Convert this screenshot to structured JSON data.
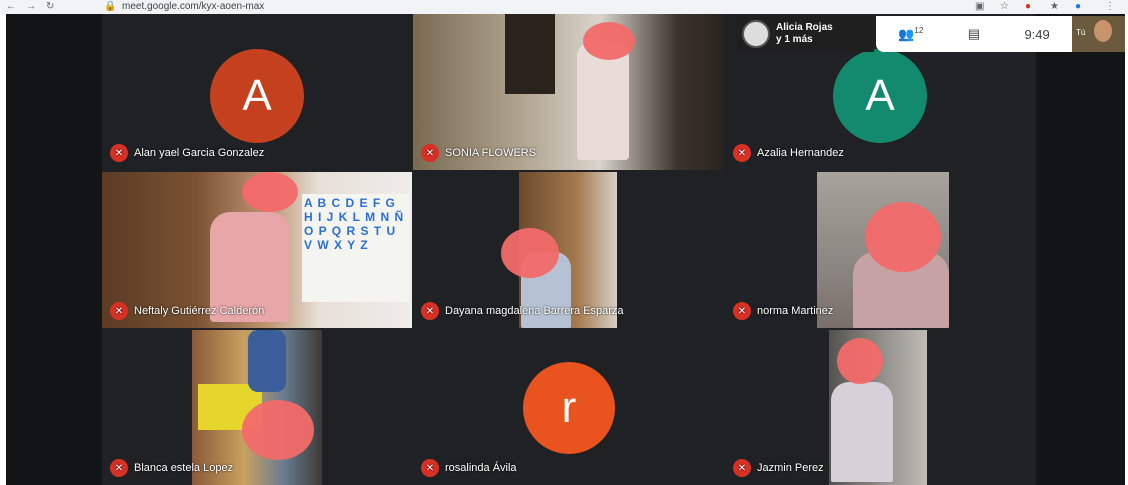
{
  "browser": {
    "url": "meet.google.com/kyx-aoen-max"
  },
  "topbar": {
    "presenter_name": "Alicia Rojas",
    "presenter_more": "y 1 más",
    "participant_count": "12",
    "time": "9:49",
    "self_label": "Tú"
  },
  "icons": {
    "mic_off": "mic-off-icon",
    "people": "people-icon",
    "chat": "chat-icon"
  },
  "colors": {
    "mic_off_red": "#d93025",
    "avatar_a1": "#c5401f",
    "avatar_a2": "#138a6e",
    "avatar_r": "#e8531f"
  },
  "tiles": [
    {
      "name": "Alan yael Garcia Gonzalez",
      "avatar": "A"
    },
    {
      "name": "SONIA FLOWERS"
    },
    {
      "name": "Azalia Hernandez",
      "avatar": "A"
    },
    {
      "name": "Neftaly Gutiérrez Calderón"
    },
    {
      "name": "Dayana magdalena Barrera Esparza"
    },
    {
      "name": "norma Martinez"
    },
    {
      "name": "Blanca estela Lopez"
    },
    {
      "name": "rosalinda Ávila",
      "avatar": "r"
    },
    {
      "name": "Jazmin Perez"
    }
  ],
  "classroom_letters": "A B C D E F G H I J K L M N Ñ O P Q R S T U V W X Y Z"
}
